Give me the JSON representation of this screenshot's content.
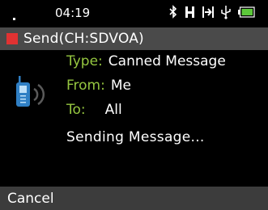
{
  "status_bar": {
    "time": "04:19",
    "icons": [
      "bluetooth-icon",
      "h-signal-icon",
      "call-forward-icon",
      "usb-icon",
      "battery-icon"
    ],
    "battery_color": "#5cc83a"
  },
  "title_bar": {
    "title": "Send(CH:SDVOA)",
    "indicator_color": "#e03232"
  },
  "message": {
    "type_label": "Type:",
    "type_value": "Canned Message",
    "from_label": "From:",
    "from_value": "Me",
    "to_label": "To:",
    "to_value": "All",
    "status": "Sending Message..."
  },
  "softkeys": {
    "left": "Cancel"
  },
  "colors": {
    "label_green": "#95c640",
    "title_bar": "#4a4a4a",
    "softkey_bar": "#3c3c3c",
    "radio_blue": "#2f7fc4"
  }
}
